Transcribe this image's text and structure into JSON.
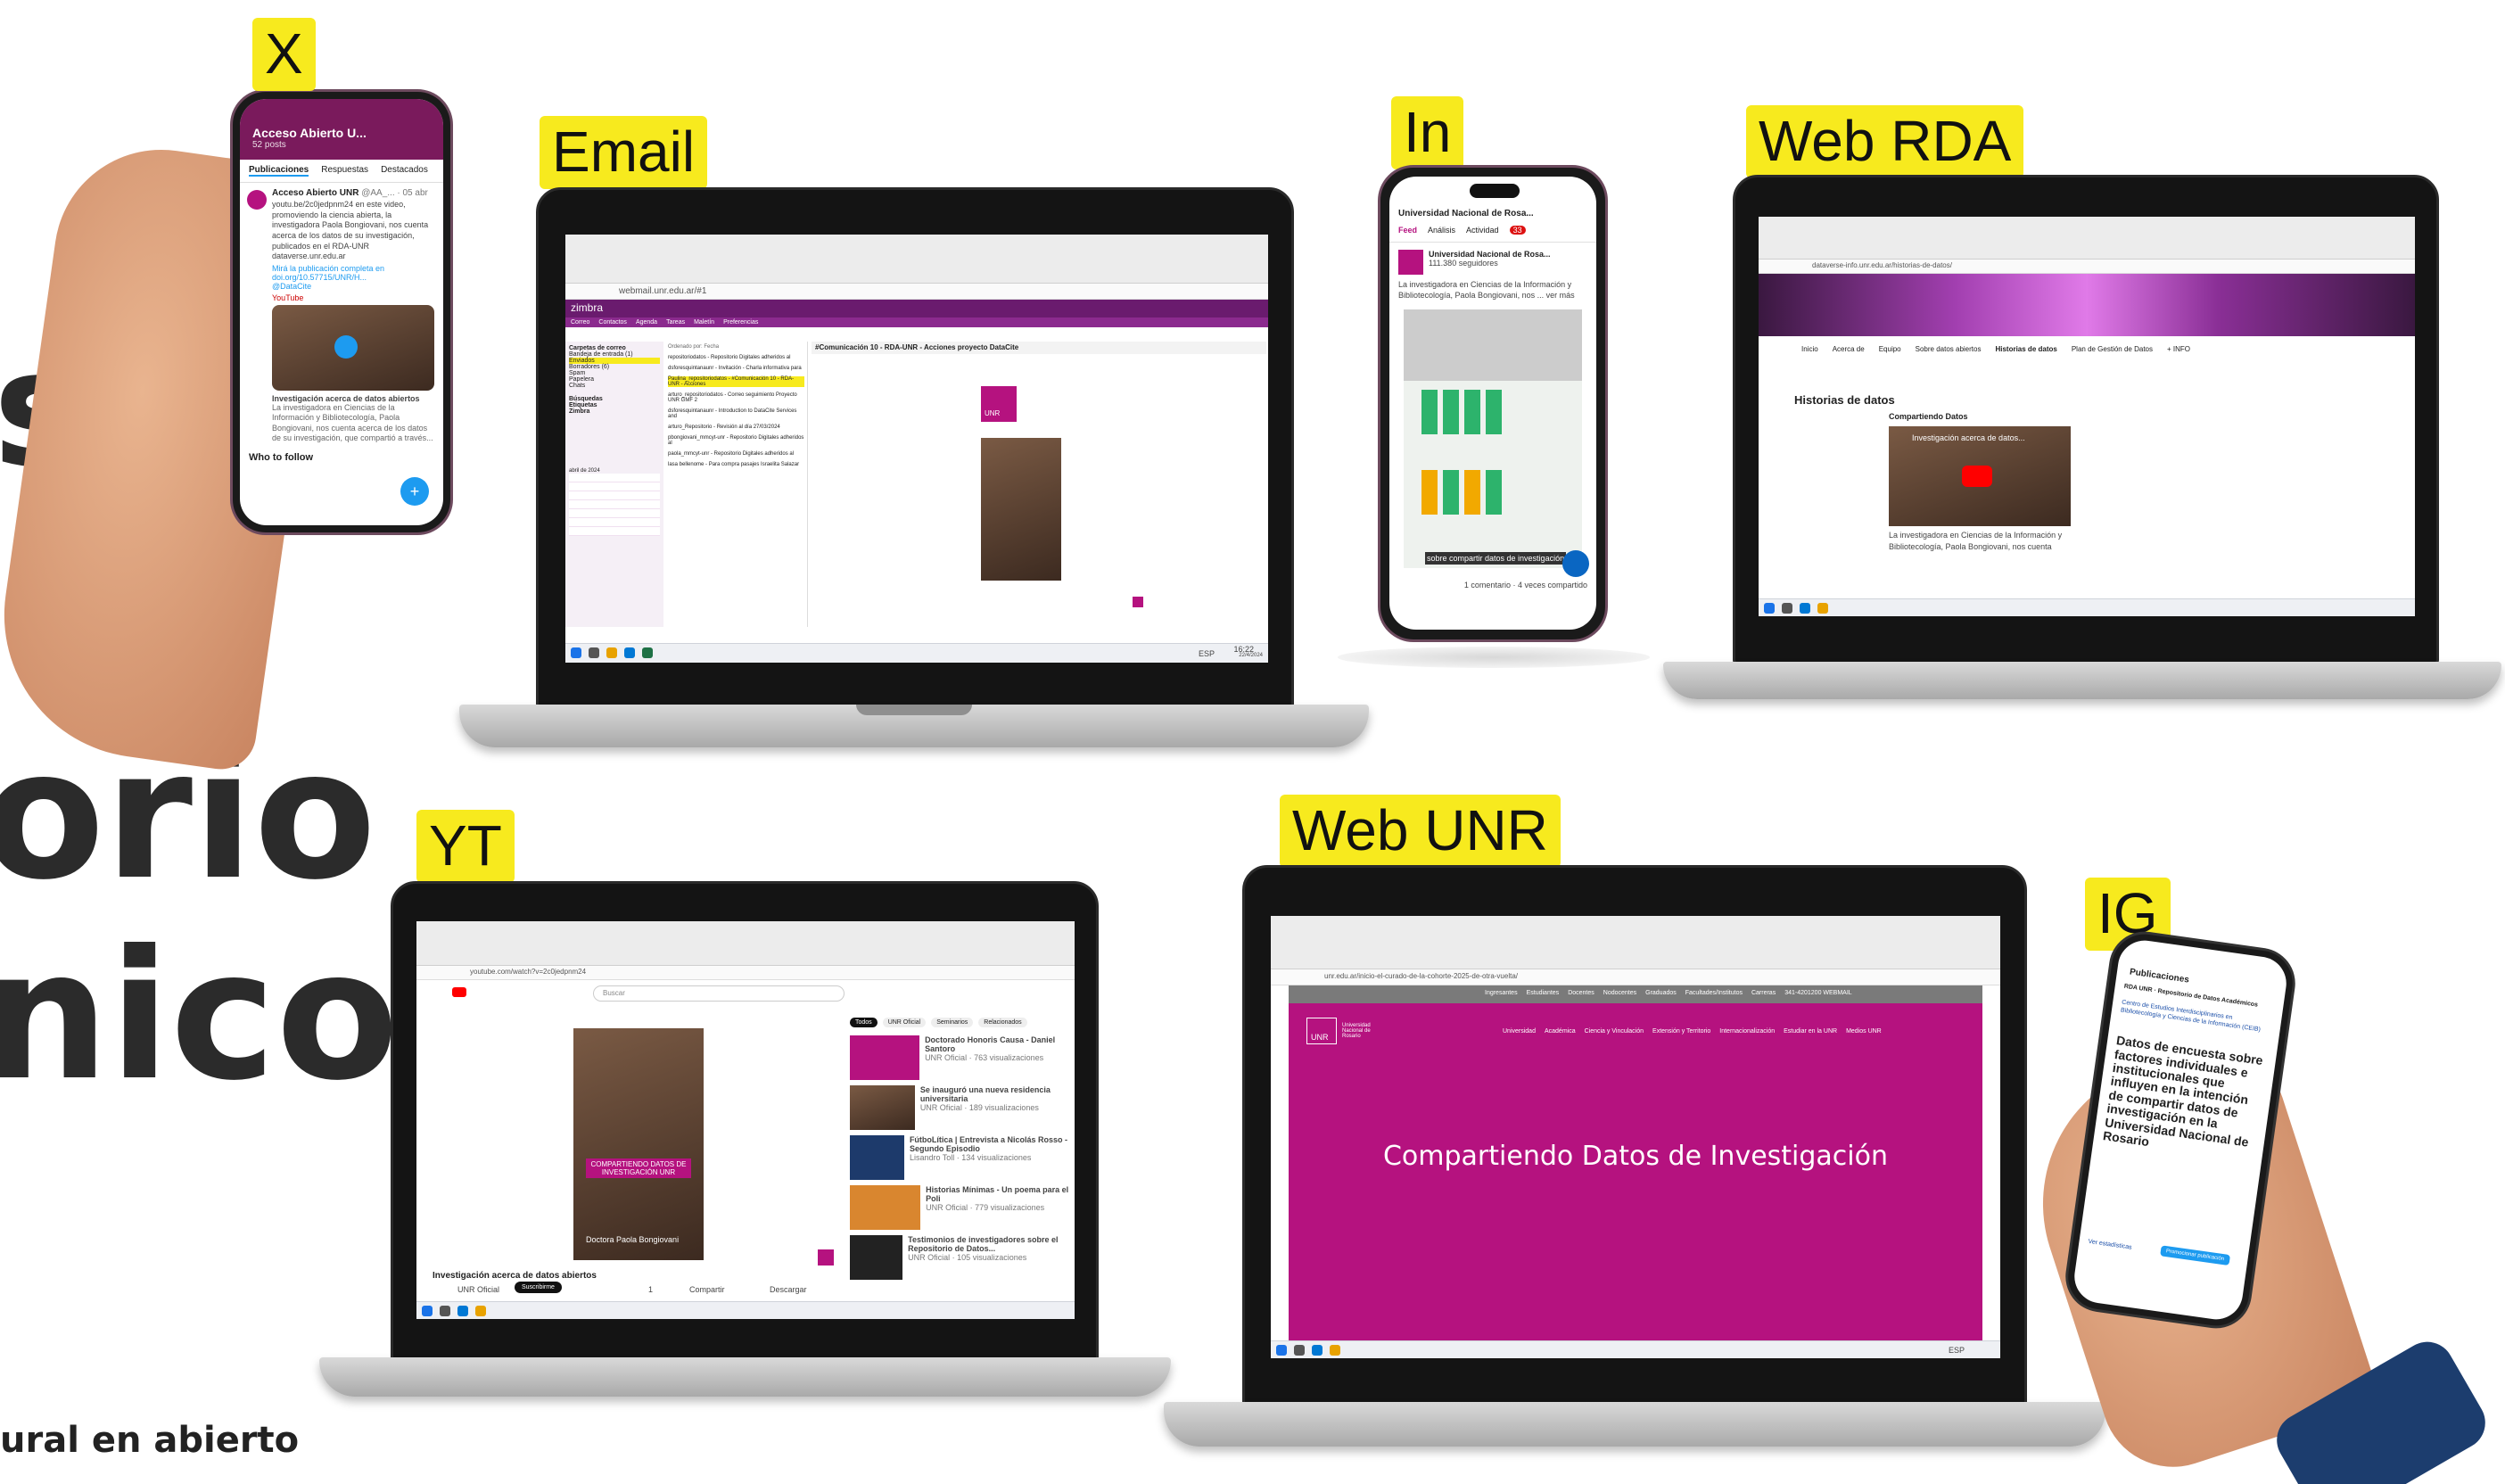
{
  "colors": {
    "tag": "#f7ea1e",
    "unr_purple": "#b5127f",
    "text_dark": "#2b2b2b"
  },
  "left_text": {
    "line1": "s",
    "line2": "orio",
    "line3": "nicos",
    "footer": "ural en abierto"
  },
  "tags": {
    "x": "X",
    "email": "Email",
    "in": "In",
    "web_rda": "Web RDA",
    "yt": "YT",
    "web_unr": "Web UNR",
    "ig": "IG"
  },
  "x_phone": {
    "header_title": "Acceso Abierto U...",
    "header_sub": "52 posts",
    "tabs": [
      "Publicaciones",
      "Respuestas",
      "Destacados"
    ],
    "post_author": "Acceso Abierto UNR",
    "post_handle": "@AA_... · 05 abr",
    "post_text": "youtu.be/2c0jedpnm24 en este video, promoviendo la ciencia abierta, la investigadora Paola Bongiovani, nos cuenta acerca de los datos de su investigación, publicados en el RDA-UNR dataverse.unr.edu.ar",
    "post_link": "Mirá la publicación completa en doi.org/10.57715/UNR/H...",
    "post_tag": "@DataCite",
    "video_source": "YouTube",
    "video_title": "Investigación acerca de datos abiertos",
    "video_desc": "La investigadora en Ciencias de la Información y Bibliotecología, Paola Bongiovani, nos cuenta acerca de los datos de su investigación, que compartió a través...",
    "who_to_follow": "Who to follow"
  },
  "email": {
    "url": "webmail.unr.edu.ar/#1",
    "app": "zimbra",
    "nav": [
      "Correo",
      "Contactos",
      "Agenda",
      "Tareas",
      "Maletín",
      "Preferencias"
    ],
    "folders_title": "Carpetas de correo",
    "folders": [
      "Bandeja de entrada (1)",
      "Enviados",
      "Borradores (6)",
      "Spam",
      "Papelera",
      "Chats"
    ],
    "sections": [
      "Búsquedas",
      "Etiquetas",
      "Zimbra"
    ],
    "list_header": "Ordenado por: Fecha",
    "messages": [
      "repositoriodatos - Repositorio Digitales adheridos al",
      "dsforesquintanaunr - Invitación - Charla informativa para",
      "Paulina_repositoriodatos - #Comunicación 10 - RDA-UNR - Acciones",
      "arturo_repositoriodatos - Correo seguimiento Proyecto UNR GMF 2",
      "dsforesquintanaunr - Introduction to DataCite Services and",
      "arturo_Repositorio - Revisión al día 27/03/2024",
      "pbongiovani_mmcyt-unr - Repositorio Digitales adheridos al",
      "paola_mmcyt-unr - Repositorio Digitales adheridos al",
      "lasa bellenome - Para compra pasajes Israelita Salazar"
    ],
    "subject": "#Comunicación 10 - RDA-UNR - Acciones proyecto DataCite",
    "calendar_month": "abril de 2024",
    "unr_logo": "UNR"
  },
  "linkedin": {
    "tabs": [
      "Feed",
      "Análisis",
      "Actividad"
    ],
    "badge": "33",
    "org_name": "Universidad Nacional de Rosa...",
    "followers": "111.380 seguidores",
    "post_text": "La investigadora en Ciencias de la Información y Bibliotecología, Paola Bongiovani, nos ... ver más",
    "overlay": "sobre compartir datos de investigación",
    "footer": "1 comentario · 4 veces compartido"
  },
  "web_rda": {
    "url": "dataverse-info.unr.edu.ar/historias-de-datos/",
    "nav": [
      "Inicio",
      "Acerca de",
      "Equipo",
      "Sobre datos abiertos",
      "Historias de datos",
      "Plan de Gestión de Datos",
      "+ INFO"
    ],
    "heading": "Historias de datos",
    "subheading": "Compartiendo Datos",
    "video_title": "Investigación acerca de datos...",
    "caption": "La investigadora en Ciencias de la Información y Bibliotecología, Paola Bongiovani, nos cuenta"
  },
  "yt": {
    "url": "youtube.com/watch?v=2c0jedpnm24",
    "search": "Buscar",
    "chips": [
      "Todos",
      "UNR Oficial",
      "Seminarios",
      "Relacionados"
    ],
    "video_title": "Investigación acerca de datos abiertos",
    "channel": "UNR Oficial",
    "subscribe": "Suscribirme",
    "likes": "1",
    "share": "Compartir",
    "download": "Descargar",
    "overlay": "COMPARTIENDO DATOS DE INVESTIGACIÓN UNR",
    "speaker": "Doctora Paola Bongiovani",
    "related": [
      {
        "title": "Doctorado Honoris Causa - Daniel Santoro",
        "meta": "UNR Oficial · 763 visualizaciones"
      },
      {
        "title": "Se inauguró una nueva residencia universitaria",
        "meta": "UNR Oficial · 189 visualizaciones"
      },
      {
        "title": "FútboLítica | Entrevista a Nicolás Rosso - Segundo Episodio",
        "meta": "Lisandro Toll · 134 visualizaciones"
      },
      {
        "title": "Historias Mínimas - Un poema para el Poli",
        "meta": "UNR Oficial · 779 visualizaciones"
      },
      {
        "title": "Testimonios de investigadores sobre el Repositorio de Datos...",
        "meta": "UNR Oficial · 105 visualizaciones"
      }
    ]
  },
  "web_unr": {
    "url": "unr.edu.ar/inicio-el-curado-de-la-cohorte-2025-de-otra-vuelta/",
    "top_links": [
      "Ingresantes",
      "Estudiantes",
      "Docentes",
      "Nodocentes",
      "Graduados",
      "Facultades/Institutos",
      "Carreras"
    ],
    "phone": "341-4201200 WEBMAIL",
    "nav": [
      "Universidad",
      "Académica",
      "Ciencia y Vinculación",
      "Extensión y Territorio",
      "Internacionalización",
      "Estudiar en la UNR",
      "Medios UNR"
    ],
    "logo": "UNR",
    "logo_text": "Universidad Nacional de Rosario",
    "hero": "Compartiendo Datos de Investigación"
  },
  "ig": {
    "header": "Publicaciones",
    "account": "RDA UNR · Repositorio de Datos Académicos",
    "link_text": "Centro de Estudios Interdisciplinarios en Bibliotecología y Ciencias de la Información (CEIB)",
    "post_text": "Datos de encuesta sobre factores individuales e institucionales que influyen en la intención de compartir datos de investigación en la Universidad Nacional de Rosario",
    "footer_link": "Ver estadísticas",
    "button": "Promocionar publicación"
  },
  "taskbar": {
    "time": "16:22",
    "date": "22/4/2024",
    "lang": "ESP"
  }
}
